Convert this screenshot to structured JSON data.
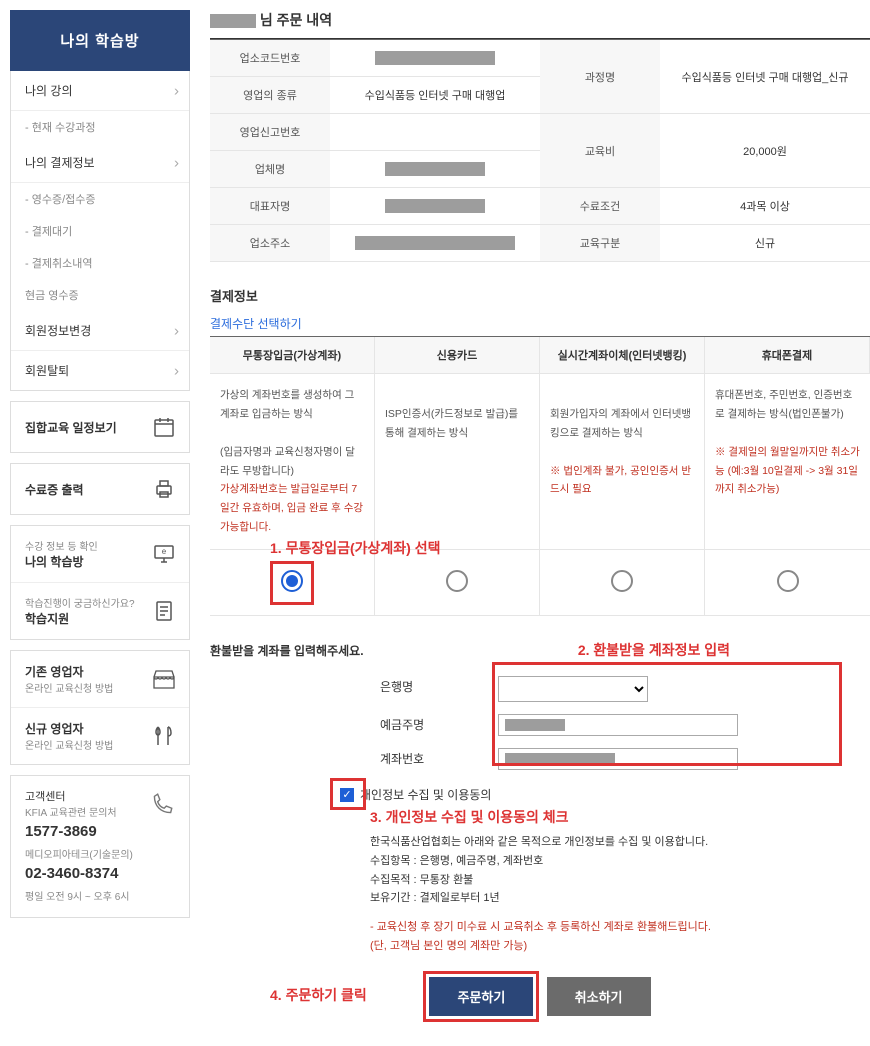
{
  "sidebar": {
    "title": "나의 학습방",
    "items": [
      {
        "label": "나의 강의",
        "type": "main"
      },
      {
        "label": "- 현재 수강과정",
        "type": "sub"
      },
      {
        "label": "나의 결제정보",
        "type": "main"
      },
      {
        "label": "- 영수증/접수증",
        "type": "sub"
      },
      {
        "label": "- 결제대기",
        "type": "sub"
      },
      {
        "label": "- 결제취소내역",
        "type": "sub"
      },
      {
        "label": "현금 영수증",
        "type": "sub"
      },
      {
        "label": "회원정보변경",
        "type": "main"
      },
      {
        "label": "회원탈퇴",
        "type": "main"
      }
    ],
    "quick": [
      {
        "sub": "",
        "main": "집합교육 일정보기",
        "icon": "calendar"
      },
      {
        "sub": "",
        "main": "수료증 출력",
        "icon": "printer"
      },
      {
        "sub": "수강 정보 등 확인",
        "main": "나의 학습방",
        "icon": "monitor"
      },
      {
        "sub": "학습진행이 궁금하신가요?",
        "main": "학습지원",
        "icon": "document"
      },
      {
        "sub": "온라인 교육신청 방법",
        "main": "기존 영업자",
        "icon": "store"
      },
      {
        "sub": "온라인 교육신청 방법",
        "main": "신규 영업자",
        "icon": "utensils"
      }
    ],
    "contact": {
      "label": "고객센터",
      "sub1": "KFIA 교육관련 문의처",
      "phone1": "1577-3869",
      "sub2": "메디오피아테크(기술문의)",
      "phone2": "02-3460-8374",
      "hours": "평일 오전 9시 ~ 오후 6시"
    }
  },
  "order": {
    "title_suffix": "님 주문 내역",
    "rows": {
      "r1": "업소코드번호",
      "r2": "영업의 종류",
      "r2v": "수입식품등 인터넷 구매 대행업",
      "r3": "영업신고번호",
      "r4": "업체명",
      "r5": "대표자명",
      "r6": "업소주소",
      "c1": "과정명",
      "c1v": "수입식품등 인터넷 구매 대행업_신규",
      "c2": "교육비",
      "c2v": "20,000원",
      "c3": "수료조건",
      "c3v": "4과목 이상",
      "c4": "교육구분",
      "c4v": "신규"
    }
  },
  "payment": {
    "heading": "결제정보",
    "choose": "결제수단 선택하기",
    "methods": [
      {
        "name": "무통장입금(가상계좌)",
        "desc1": "가상의 계좌번호를 생성하여 그 계좌로 입금하는 방식",
        "desc2": "(입금자명과 교육신청자명이 달라도 무방합니다)",
        "warn": "가상계좌번호는 발급일로부터 7일간 유효하며, 입금 완료 후 수강 가능합니다."
      },
      {
        "name": "신용카드",
        "desc1": "ISP인증서(카드정보로 발급)를 통해 결제하는 방식"
      },
      {
        "name": "실시간계좌이체(인터넷뱅킹)",
        "desc1": "회원가입자의 계좌에서 인터넷뱅킹으로 결제하는 방식",
        "warn": "※ 법인계좌 불가, 공인인증서 반드시 필요"
      },
      {
        "name": "휴대폰결제",
        "desc1": "휴대폰번호, 주민번호, 인증번호로 결제하는 방식(법인폰불가)",
        "warn": "※ 결제일의 월말일까지만 취소가능 (예:3월 10일결제 -> 3월 31일까지 취소가능)"
      }
    ],
    "annotations": {
      "a1": "1. 무통장입금(가상계좌) 선택",
      "a2": "2. 환불받을 계좌정보 입력",
      "a3": "3. 개인정보 수집 및 이용동의 체크",
      "a4": "4. 주문하기 클릭"
    }
  },
  "refund": {
    "heading": "환불받을 계좌를 입력해주세요.",
    "fields": {
      "bank": "은행명",
      "holder": "예금주명",
      "account": "계좌번호"
    }
  },
  "consent": {
    "label": "개인정보 수집 및 이용동의",
    "desc1": "한국식품산업협회는 아래와 같은 목적으로 개인정보를 수집 및 이용합니다.",
    "desc2": "수집항목 : 은행명, 예금주명, 계좌번호",
    "desc3": "수집목적 : 무통장 환불",
    "desc4": "보유기간 : 결제일로부터 1년",
    "warn1": "- 교육신청 후 장기 미수료 시 교육취소 후 등록하신 계좌로 환불해드립니다.",
    "warn2": "(단, 고객님 본인 명의 계좌만 가능)"
  },
  "buttons": {
    "submit": "주문하기",
    "cancel": "취소하기"
  }
}
